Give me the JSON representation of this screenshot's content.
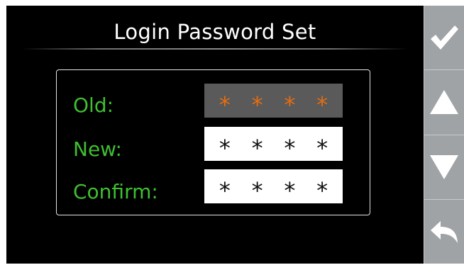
{
  "screen": {
    "title": "Login Password Set"
  },
  "fields": [
    {
      "label": "Old:",
      "mask": [
        "*",
        "*",
        "*",
        "*"
      ],
      "state": "active"
    },
    {
      "label": "New:",
      "mask": [
        "*",
        "*",
        "*",
        "*"
      ],
      "state": "normal"
    },
    {
      "label": "Confirm:",
      "mask": [
        "*",
        "*",
        "*",
        "*"
      ],
      "state": "normal"
    }
  ],
  "sidebar": {
    "buttons": [
      {
        "icon": "checkmark-icon"
      },
      {
        "icon": "arrow-up-icon"
      },
      {
        "icon": "arrow-down-icon"
      },
      {
        "icon": "back-icon"
      }
    ]
  },
  "colors": {
    "screen_background": "#000000",
    "label_green": "#3fbf30",
    "active_mask_orange": "#e36d12",
    "active_field_background": "#5a5a5a",
    "sidebar_background": "#a0a3a5"
  }
}
